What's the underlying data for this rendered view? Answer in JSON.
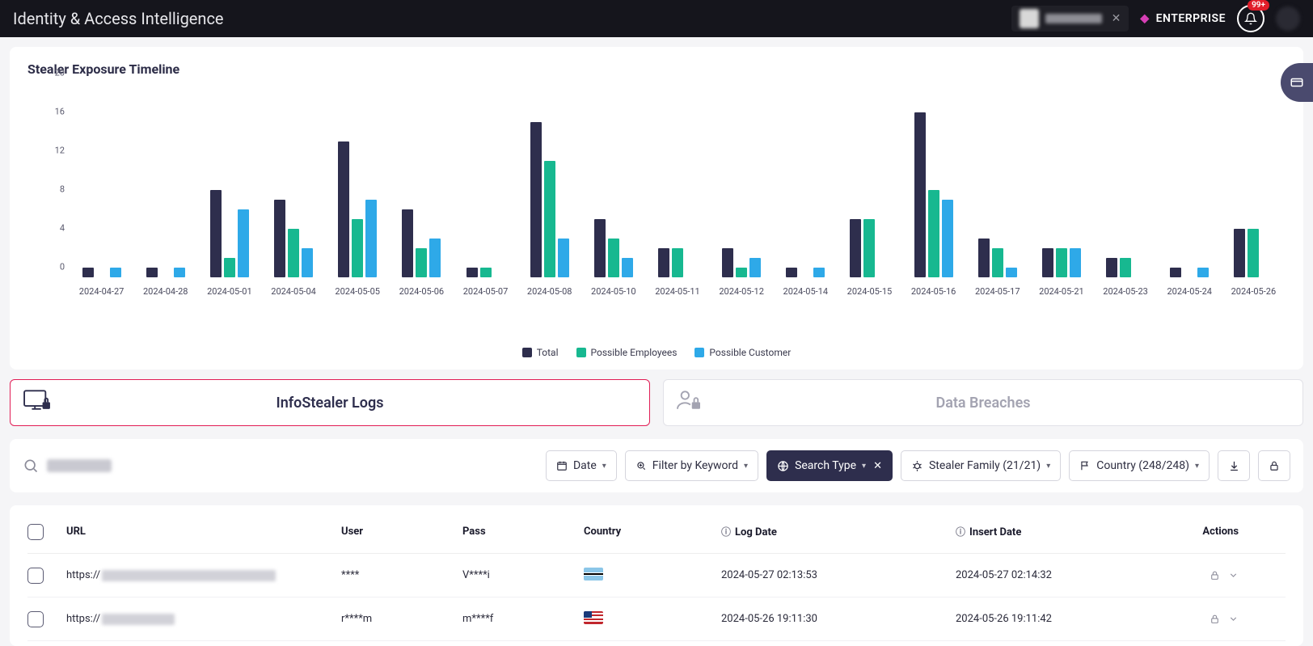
{
  "header": {
    "title": "Identity & Access Intelligence",
    "enterprise_label": "ENTERPRISE",
    "badge": "99+"
  },
  "chart_card_title": "Stealer Exposure Timeline",
  "chart_data": {
    "type": "bar",
    "title": "Stealer Exposure Timeline",
    "xlabel": "",
    "ylabel": "",
    "ylim": [
      0,
      20
    ],
    "yticks": [
      0,
      4,
      8,
      12,
      16,
      20
    ],
    "categories": [
      "2024-04-27",
      "2024-04-28",
      "2024-05-01",
      "2024-05-04",
      "2024-05-05",
      "2024-05-06",
      "2024-05-07",
      "2024-05-08",
      "2024-05-10",
      "2024-05-11",
      "2024-05-12",
      "2024-05-14",
      "2024-05-15",
      "2024-05-16",
      "2024-05-17",
      "2024-05-21",
      "2024-05-23",
      "2024-05-24",
      "2024-05-26"
    ],
    "series": [
      {
        "name": "Total",
        "color": "#2e2e4d",
        "values": [
          1,
          1,
          9,
          8,
          14,
          7,
          1,
          16,
          6,
          3,
          3,
          1,
          6,
          17,
          4,
          3,
          2,
          1,
          5
        ]
      },
      {
        "name": "Possible Employees",
        "color": "#17b890",
        "values": [
          0,
          0,
          2,
          5,
          6,
          3,
          1,
          12,
          4,
          3,
          1,
          0,
          6,
          9,
          3,
          3,
          2,
          0,
          5
        ]
      },
      {
        "name": "Possible Customer",
        "color": "#2ea9e8",
        "values": [
          1,
          1,
          7,
          3,
          8,
          4,
          0,
          4,
          2,
          0,
          2,
          1,
          0,
          8,
          1,
          3,
          0,
          1,
          0
        ]
      }
    ]
  },
  "tabs": {
    "infostealer": "InfoStealer Logs",
    "breaches": "Data Breaches"
  },
  "filters": {
    "date_label": "Date",
    "keyword_label": "Filter by Keyword",
    "search_type_label": "Search Type",
    "stealer_family_label": "Stealer Family (21/21)",
    "country_label": "Country (248/248)"
  },
  "table": {
    "headers": {
      "url": "URL",
      "user": "User",
      "pass": "Pass",
      "country": "Country",
      "log_date": "Log Date",
      "insert_date": "Insert Date",
      "actions": "Actions"
    },
    "rows": [
      {
        "url_prefix": "https://",
        "user": "****",
        "pass": "V****i",
        "country_code": "BW",
        "log_date": "2024-05-27 02:13:53",
        "insert_date": "2024-05-27 02:14:32"
      },
      {
        "url_prefix": "https://",
        "user": "r****m",
        "pass": "m****f",
        "country_code": "US",
        "log_date": "2024-05-26 19:11:30",
        "insert_date": "2024-05-26 19:11:42"
      }
    ]
  }
}
